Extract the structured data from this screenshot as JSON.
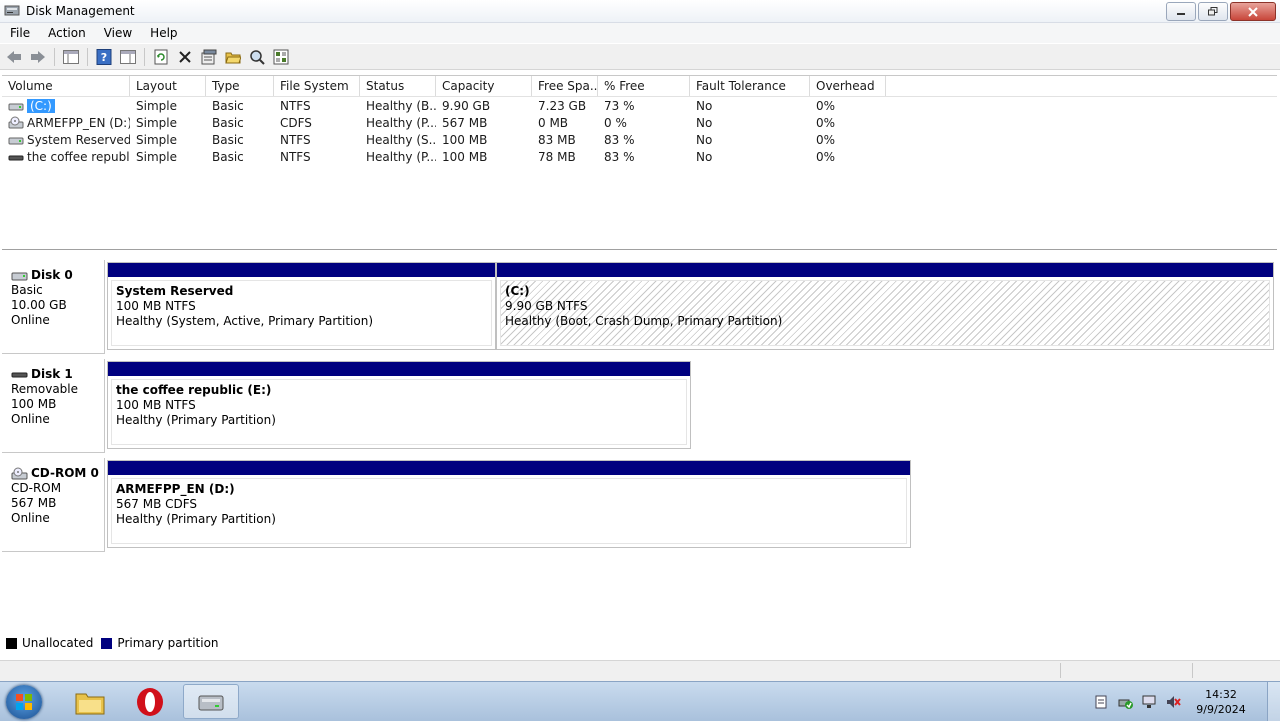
{
  "window": {
    "title": "Disk Management"
  },
  "menu": [
    {
      "label": "File"
    },
    {
      "label": "Action"
    },
    {
      "label": "View"
    },
    {
      "label": "Help"
    }
  ],
  "toolbar": {
    "icons": [
      "back-icon",
      "forward-icon",
      "console-tree-icon",
      "help-icon",
      "properties-pane-icon",
      "refresh-icon",
      "delete-icon",
      "properties-icon",
      "open-icon",
      "rescan-icon",
      "settings-icon"
    ]
  },
  "volume_list": {
    "columns": [
      "Volume",
      "Layout",
      "Type",
      "File System",
      "Status",
      "Capacity",
      "Free Spa...",
      "% Free",
      "Fault Tolerance",
      "Overhead"
    ],
    "rows": [
      {
        "volume": "(C:)",
        "layout": "Simple",
        "type": "Basic",
        "fs": "NTFS",
        "status": "Healthy (B...",
        "capacity": "9.90 GB",
        "free": "7.23 GB",
        "pct": "73 %",
        "fault": "No",
        "overhead": "0%",
        "selected": true
      },
      {
        "volume": "ARMEFPP_EN (D:)",
        "layout": "Simple",
        "type": "Basic",
        "fs": "CDFS",
        "status": "Healthy (P...",
        "capacity": "567 MB",
        "free": "0 MB",
        "pct": "0 %",
        "fault": "No",
        "overhead": "0%"
      },
      {
        "volume": "System Reserved",
        "layout": "Simple",
        "type": "Basic",
        "fs": "NTFS",
        "status": "Healthy (S...",
        "capacity": "100 MB",
        "free": "83 MB",
        "pct": "83 %",
        "fault": "No",
        "overhead": "0%"
      },
      {
        "volume": "the coffee republi...",
        "layout": "Simple",
        "type": "Basic",
        "fs": "NTFS",
        "status": "Healthy (P...",
        "capacity": "100 MB",
        "free": "78 MB",
        "pct": "83 %",
        "fault": "No",
        "overhead": "0%"
      }
    ]
  },
  "disks": [
    {
      "name": "Disk 0",
      "type": "Basic",
      "size": "10.00 GB",
      "state": "Online",
      "partitions": [
        {
          "name": "System Reserved",
          "detail": "100 MB NTFS",
          "status": "Healthy (System, Active, Primary Partition)"
        },
        {
          "name": "(C:)",
          "detail": "9.90 GB NTFS",
          "status": "Healthy (Boot, Crash Dump, Primary Partition)"
        }
      ]
    },
    {
      "name": "Disk 1",
      "type": "Removable",
      "size": "100 MB",
      "state": "Online",
      "partitions": [
        {
          "name": "the coffee republic  (E:)",
          "detail": "100 MB NTFS",
          "status": "Healthy (Primary Partition)"
        }
      ]
    },
    {
      "name": "CD-ROM 0",
      "type": "CD-ROM",
      "size": "567 MB",
      "state": "Online",
      "partitions": [
        {
          "name": "ARMEFPP_EN  (D:)",
          "detail": "567 MB CDFS",
          "status": "Healthy (Primary Partition)"
        }
      ]
    }
  ],
  "legend": [
    {
      "label": "Unallocated",
      "color": "#000000"
    },
    {
      "label": "Primary partition",
      "color": "#00007f"
    }
  ],
  "colors": {
    "partition_bar": "#00007f",
    "selection": "#3399ff"
  },
  "taskbar": {
    "apps": [
      "explorer-icon",
      "opera-icon",
      "disk-management-icon"
    ],
    "clock": {
      "time": "14:32",
      "date": "9/9/2024"
    }
  }
}
